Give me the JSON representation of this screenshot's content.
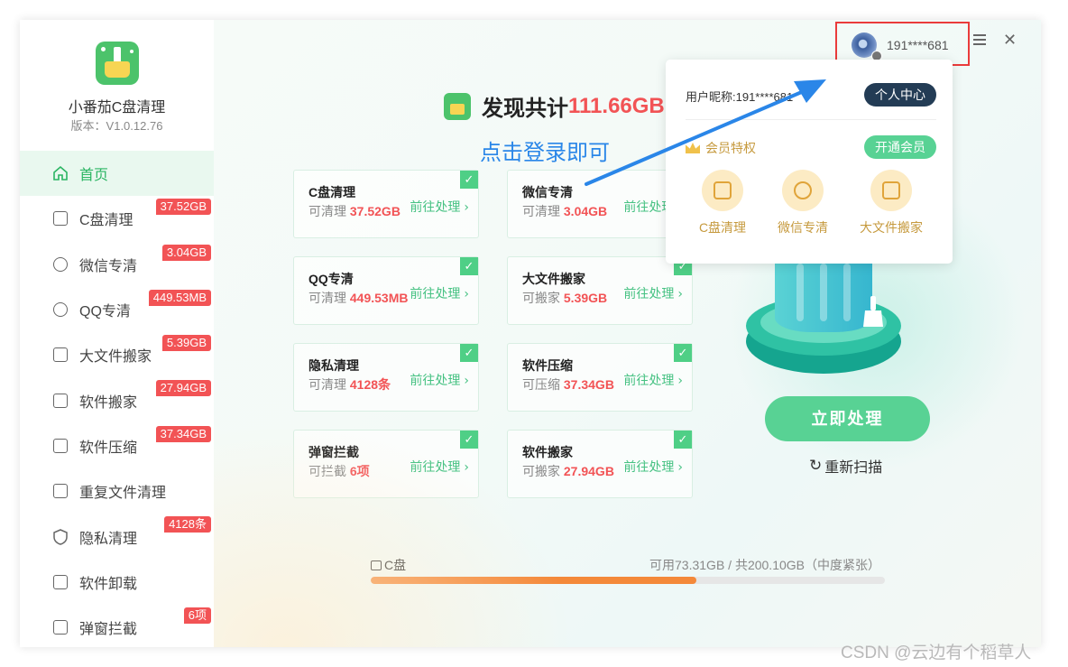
{
  "app": {
    "name": "小番茄C盘清理",
    "version": "版本：V1.0.12.76"
  },
  "sidebar": {
    "items": [
      {
        "label": "首页",
        "icon": "home-icon",
        "badge": ""
      },
      {
        "label": "C盘清理",
        "icon": "basket-icon",
        "badge": "37.52GB"
      },
      {
        "label": "微信专清",
        "icon": "wechat-icon",
        "badge": "3.04GB"
      },
      {
        "label": "QQ专清",
        "icon": "qq-icon",
        "badge": "449.53MB"
      },
      {
        "label": "大文件搬家",
        "icon": "file-icon",
        "badge": "5.39GB"
      },
      {
        "label": "软件搬家",
        "icon": "box-icon",
        "badge": "27.94GB"
      },
      {
        "label": "软件压缩",
        "icon": "zip-icon",
        "badge": "37.34GB"
      },
      {
        "label": "重复文件清理",
        "icon": "duplicate-icon",
        "badge": ""
      },
      {
        "label": "隐私清理",
        "icon": "shield-icon",
        "badge": "4128条"
      },
      {
        "label": "软件卸载",
        "icon": "uninstall-icon",
        "badge": ""
      },
      {
        "label": "弹窗拦截",
        "icon": "popup-icon",
        "badge": "6项"
      }
    ]
  },
  "main": {
    "headline_prefix": "发现共计",
    "headline_size": "111.66GB",
    "annotation": "点击登录即可",
    "go_label": "前往处理",
    "cards": [
      {
        "title": "C盘清理",
        "sub": "可清理",
        "value": "37.52GB"
      },
      {
        "title": "微信专清",
        "sub": "可清理",
        "value": "3.04GB"
      },
      {
        "title": "QQ专清",
        "sub": "可清理",
        "value": "449.53MB"
      },
      {
        "title": "大文件搬家",
        "sub": "可搬家",
        "value": "5.39GB"
      },
      {
        "title": "隐私清理",
        "sub": "可清理",
        "value": "4128条"
      },
      {
        "title": "软件压缩",
        "sub": "可压缩",
        "value": "37.34GB"
      },
      {
        "title": "弹窗拦截",
        "sub": "可拦截",
        "value": "6项"
      },
      {
        "title": "软件搬家",
        "sub": "可搬家",
        "value": "27.94GB"
      }
    ],
    "process_button": "立即处理",
    "rescan": "重新扫描",
    "disk": {
      "label": "C盘",
      "info": "可用73.31GB /  共200.10GB（中度紧张）",
      "used_fraction": 0.634
    }
  },
  "user": {
    "name": "191****681"
  },
  "dropdown": {
    "nickname": "用户昵称:191****681",
    "center_button": "个人中心",
    "vip_label": "会员特权",
    "open_vip_button": "开通会员",
    "features": [
      "C盘清理",
      "微信专清",
      "大文件搬家"
    ]
  },
  "colors": {
    "accent": "#58d294",
    "badge": "#f25355",
    "annotation": "#2a86e8",
    "highlight_box": "#ea3b3b"
  },
  "watermark": "CSDN @云边有个稻草人"
}
